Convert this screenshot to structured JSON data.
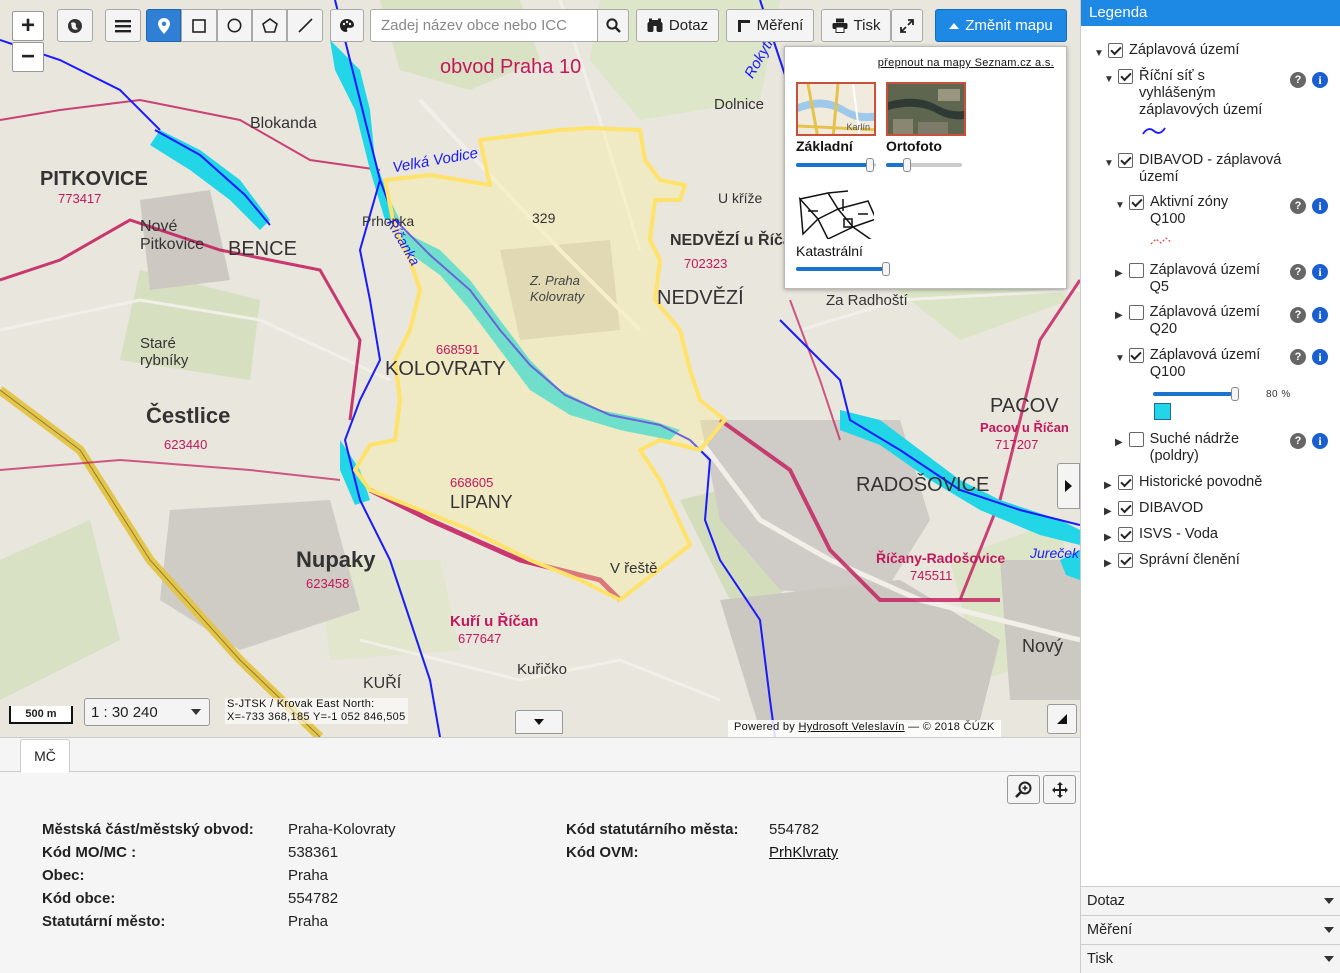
{
  "toolbar": {
    "search_placeholder": "Zadej název obce nebo ICC",
    "dotaz_label": "Dotaz",
    "mereni_label": "Měření",
    "tisk_label": "Tisk",
    "zmenit_label": "Změnit mapu"
  },
  "basemap": {
    "seznam_link": "přepnout na mapy Seznam.cz a.s.",
    "items": [
      {
        "label": "Základní",
        "thumb_text": "Karlín",
        "opacity": 0.95
      },
      {
        "label": "Ortofoto",
        "opacity": 0.3
      },
      {
        "label": "Katastrální",
        "opacity": 1.0
      }
    ]
  },
  "map": {
    "scale_bar": "500 m",
    "scale_value": "1 : 30 240",
    "coords_line1": "S-JTSK / Krovak East North:",
    "coords_line2": "X=-733 368,185 Y=-1 052 846,505",
    "credits_prefix": "Powered by ",
    "credits_link": "Hydrosoft Veleslavín",
    "credits_suffix": " — © 2018 ČÚZK",
    "labels": {
      "obvod": "obvod Praha 10",
      "blokanda": "Blokanda",
      "dolnice": "Dolnice",
      "pitkovice": "PITKOVICE",
      "pitkovice_code": "773417",
      "nove_pitkovice": "Nové Pitkovice",
      "bence": "BENCE",
      "velka_vodice": "Velká Vodice",
      "prhonka": "Prhonka",
      "ricanka": "Říčanka",
      "c329": "329",
      "zpraha": "Z. Praha Kolovraty",
      "k_krize": "U kříže",
      "nedvezi_ur": "NEDVĚZÍ u Říčan",
      "nedvezi_code": "702323",
      "nedvezi": "NEDVĚZÍ",
      "za_radhosti": "Za Radhoští",
      "stare_rybniky": "Staré rybníky",
      "kolovraty": "KOLOVRATY",
      "kolovraty_code": "668591",
      "cestlice": "Čestlice",
      "cestlice_code": "623440",
      "lipany_code": "668605",
      "lipany": "LIPANY",
      "nupaky": "Nupaky",
      "nupaky_code": "623458",
      "kuri_u_rican": "Kuří u Říčan",
      "kuri_code": "677647",
      "kuricko": "Kuřičko",
      "kuri": "KUŘÍ",
      "vresti": "V řeště",
      "pacov": "PACOV",
      "pacov_ur": "Pacov u Říčan",
      "pacov_code": "717207",
      "radosovice": "RADOŠOVICE",
      "ricany_rad": "Říčany-Radošovice",
      "ricany_code": "745511",
      "jurecek": "Jureček",
      "novy": "Nový",
      "rokytka": "Rokytka"
    }
  },
  "info": {
    "tab": "MČ",
    "left": [
      {
        "key": "Městská část/městský obvod:",
        "value": "Praha-Kolovraty"
      },
      {
        "key": "Kód MO/MC :",
        "value": "538361"
      },
      {
        "key": "Obec:",
        "value": "Praha"
      },
      {
        "key": "Kód obce:",
        "value": "554782"
      },
      {
        "key": "Statutární město:",
        "value": "Praha"
      }
    ],
    "right": [
      {
        "key": "Kód statutárního města:",
        "value": "554782"
      },
      {
        "key": "Kód OVM:",
        "value": "PrhKlvraty"
      }
    ]
  },
  "legend": {
    "title": "Legenda",
    "items": [
      {
        "label": "Záplavová území",
        "checked": true
      },
      {
        "label": "Říční síť s vyhlášeným záplavových území",
        "checked": true
      },
      {
        "label": "DIBAVOD - záplavová území",
        "checked": true
      },
      {
        "label": "Aktivní zóny Q100",
        "checked": true
      },
      {
        "label": "Záplavová území Q5",
        "checked": false
      },
      {
        "label": "Záplavová území Q20",
        "checked": false
      },
      {
        "label": "Záplavová území Q100",
        "checked": true
      },
      {
        "label": "Suché nádrže (poldry)",
        "checked": false
      },
      {
        "label": "Historické povodně",
        "checked": true
      },
      {
        "label": "DIBAVOD",
        "checked": true
      },
      {
        "label": "ISVS - Voda",
        "checked": true
      },
      {
        "label": "Správní členění",
        "checked": true
      }
    ],
    "opacity_value": "80 %",
    "opacity_fraction": 0.8,
    "accordion": [
      "Dotaz",
      "Měření",
      "Tisk"
    ]
  },
  "colors": {
    "accent": "#1e88e5",
    "flood": "#22d6e8",
    "river": "#1a1aff",
    "boundary": "#c2185b",
    "selection": "#ffe26a"
  }
}
